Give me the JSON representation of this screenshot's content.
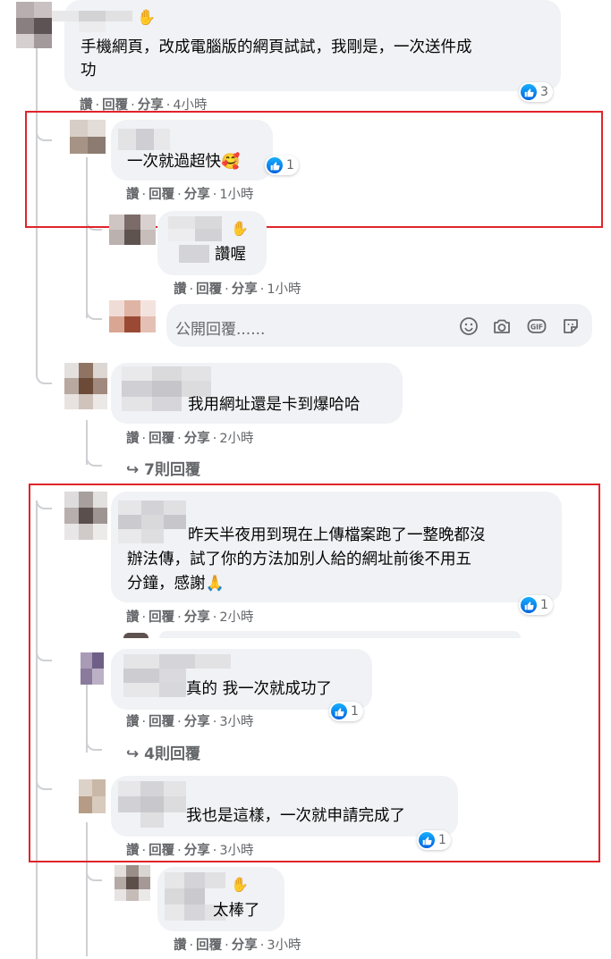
{
  "comments": [
    {
      "id": "c1",
      "text_lines": [
        "手機網頁，改成電腦版的網頁試試，我剛是，一次送件成",
        "功"
      ],
      "actions": {
        "like": "讚",
        "reply": "回覆",
        "share": "分享",
        "time": "4小時"
      },
      "reactions": "3"
    },
    {
      "id": "c2",
      "text": "一次就過超快",
      "emoji": "🥰",
      "actions": {
        "like": "讚",
        "reply": "回覆",
        "share": "分享",
        "time": "1小時"
      },
      "reactions": "1"
    },
    {
      "id": "c3",
      "text": "讚喔",
      "actions": {
        "like": "讚",
        "reply": "回覆",
        "share": "分享",
        "time": "1小時"
      }
    },
    {
      "id": "c4",
      "text": "我用網址還是卡到爆哈哈",
      "actions": {
        "like": "讚",
        "reply": "回覆",
        "share": "分享",
        "time": "2小時"
      },
      "more_replies": "7則回覆"
    },
    {
      "id": "c5",
      "text_lines": [
        "昨天半夜用到現在上傳檔案跑了一整晚都沒",
        "辦法傳，試了你的方法加別人給的網址前後不用五",
        "分鐘，感謝"
      ],
      "emoji": "🙏",
      "actions": {
        "like": "讚",
        "reply": "回覆",
        "share": "分享",
        "time": "2小時"
      },
      "reactions": "1"
    },
    {
      "id": "c6",
      "text": "真的 我一次就成功了",
      "actions": {
        "like": "讚",
        "reply": "回覆",
        "share": "分享",
        "time": "3小時"
      },
      "reactions": "1",
      "more_replies": "4則回覆"
    },
    {
      "id": "c7",
      "text": "我也是這樣，一次就申請完成了",
      "actions": {
        "like": "讚",
        "reply": "回覆",
        "share": "分享",
        "time": "3小時"
      },
      "reactions": "1"
    },
    {
      "id": "c8",
      "text": "太棒了",
      "actions": {
        "like": "讚",
        "reply": "回覆",
        "share": "分享",
        "time": "3小時"
      }
    }
  ],
  "reply_box": {
    "placeholder": "公開回覆......",
    "icons": [
      "emoji-icon",
      "camera-icon",
      "gif-icon",
      "sticker-icon"
    ]
  },
  "colors": {
    "bubble": "#f0f2f5",
    "meta": "#65676b",
    "like": "#1877f2",
    "highlight": "#e0242a"
  }
}
